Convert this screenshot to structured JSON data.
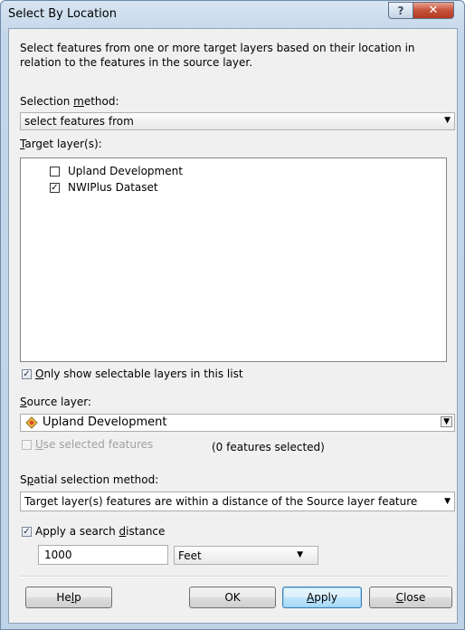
{
  "window": {
    "title": "Select By Location",
    "help_glyph": "?",
    "close_glyph": "✕"
  },
  "description": "Select features from one or more target layers based on their location in relation to the features in the source layer.",
  "selection_method": {
    "label_pre": "Selection ",
    "label_acc": "m",
    "label_post": "ethod:",
    "value": "select features from"
  },
  "target_layers": {
    "label_acc": "T",
    "label_post": "arget layer(s):",
    "items": [
      {
        "label": "Upland Development",
        "checked": false
      },
      {
        "label": "NWIPlus Dataset",
        "checked": true
      }
    ]
  },
  "only_selectable": {
    "label_acc": "O",
    "label_post": "nly show selectable layers in this list",
    "checked": true
  },
  "source_layer": {
    "label_acc": "S",
    "label_post": "ource layer:",
    "value": "Upland Development",
    "icon": "layer-icon"
  },
  "use_selected": {
    "label_acc": "U",
    "label_post": "se selected features",
    "checked": false,
    "count_text": "(0 features selected)"
  },
  "spatial_method": {
    "label_pre": "S",
    "label_acc": "p",
    "label_post": "atial selection method:",
    "value": "Target layer(s) features are within a distance of the Source layer feature"
  },
  "search_distance": {
    "label_pre": "Apply a search ",
    "label_acc": "d",
    "label_post": "istance",
    "checked": true,
    "value": "1000",
    "unit": "Feet"
  },
  "buttons": {
    "help": {
      "pre": "He",
      "acc": "l",
      "post": "p"
    },
    "ok": "OK",
    "apply": {
      "acc": "A",
      "post": "pply"
    },
    "close": {
      "acc": "C",
      "post": "lose"
    }
  },
  "colors": {
    "titlebar": "#c4d6ea",
    "close_button": "#c7513a",
    "client_bg": "#f0f0f0"
  }
}
